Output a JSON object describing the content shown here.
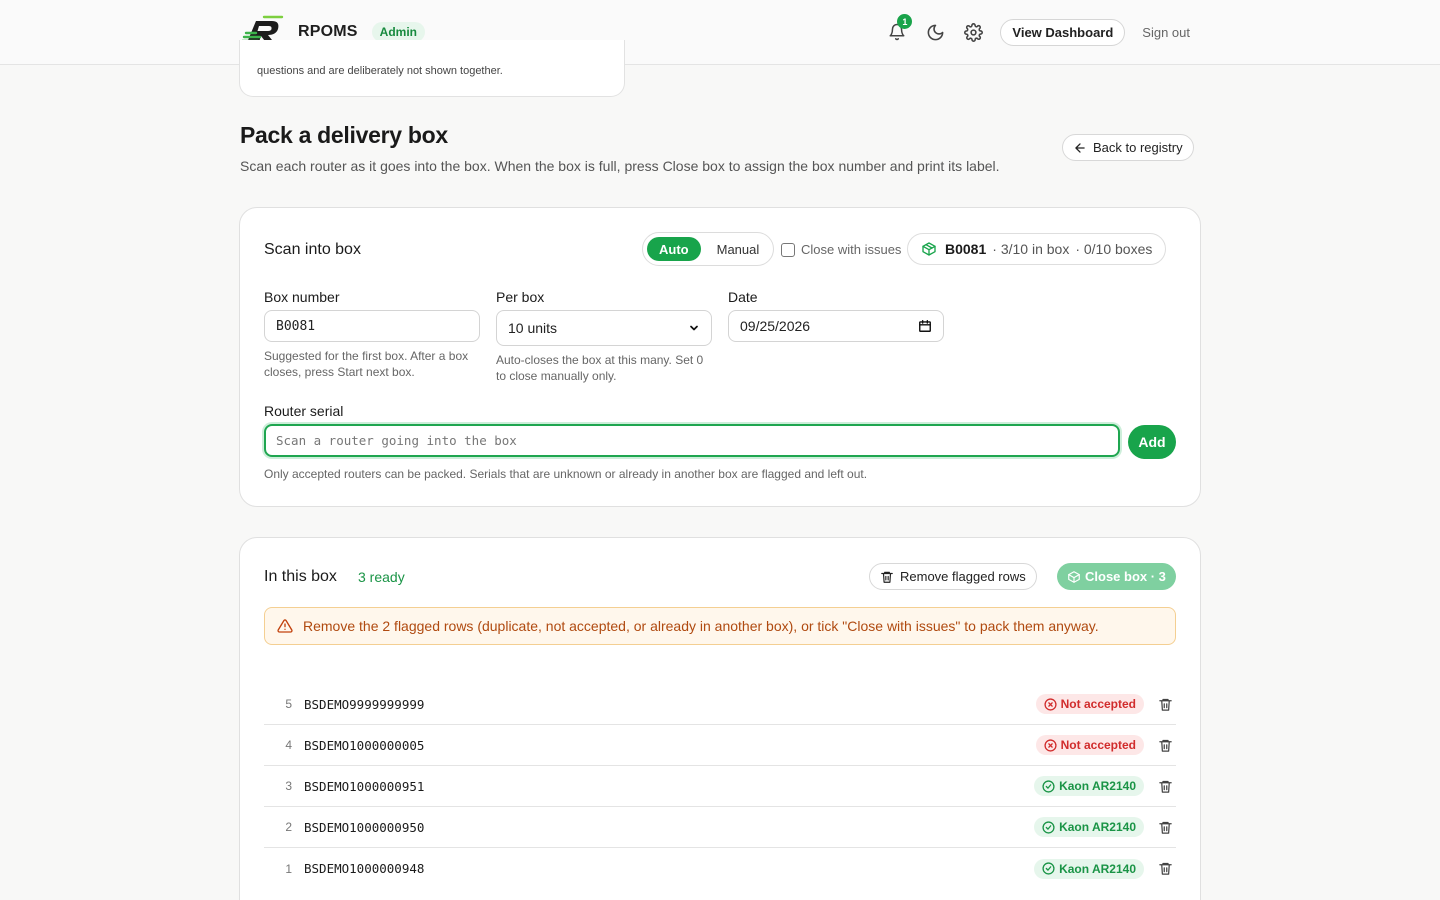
{
  "header": {
    "app_name": "RPOMS",
    "role": "Admin",
    "notification_count": "1",
    "view_dashboard": "View Dashboard",
    "sign_out": "Sign out"
  },
  "top_card": {
    "text": "questions and are deliberately not shown together."
  },
  "page": {
    "title": "Pack a delivery box",
    "subtitle": "Scan each router as it goes into the box. When the box is full, press Close box to assign the box number and print its label.",
    "back_label": "Back to registry"
  },
  "scan": {
    "title": "Scan into box",
    "mode_auto": "Auto",
    "mode_manual": "Manual",
    "close_with_issues": "Close with issues",
    "box_number_status": "B0081",
    "box_fill_status": "· 3/10 in box",
    "boxes_status": "· 0/10 boxes",
    "box_number_label": "Box number",
    "box_number_value": "B0081",
    "box_number_help": "Suggested for the first box. After a box closes, press Start next box.",
    "per_box_label": "Per box",
    "per_box_value": "10 units",
    "per_box_help": "Auto-closes the box at this many. Set 0 to close manually only.",
    "date_label": "Date",
    "date_value": "09/25/2026",
    "serial_label": "Router serial",
    "serial_placeholder": "Scan a router going into the box",
    "add_label": "Add",
    "serial_help": "Only accepted routers can be packed. Serials that are unknown or already in another box are flagged and left out."
  },
  "box": {
    "title": "In this box",
    "ready": "3 ready",
    "remove_flagged": "Remove flagged rows",
    "close_box": "Close box · 3",
    "alert": "Remove the 2 flagged rows (duplicate, not accepted, or already in another box), or tick \"Close with issues\" to pack them anyway.",
    "rows": [
      {
        "num": "5",
        "serial": "BSDEMO9999999999",
        "status": "Not accepted",
        "kind": "bad"
      },
      {
        "num": "4",
        "serial": "BSDEMO1000000005",
        "status": "Not accepted",
        "kind": "bad"
      },
      {
        "num": "3",
        "serial": "BSDEMO1000000951",
        "status": "Kaon AR2140",
        "kind": "good"
      },
      {
        "num": "2",
        "serial": "BSDEMO1000000950",
        "status": "Kaon AR2140",
        "kind": "good"
      },
      {
        "num": "1",
        "serial": "BSDEMO1000000948",
        "status": "Kaon AR2140",
        "kind": "good"
      }
    ]
  },
  "colors": {
    "accent": "#18a44b",
    "danger": "#d12c2c",
    "warning": "#b04a10"
  },
  "icons": [
    "logo-icon",
    "bell-icon",
    "moon-icon",
    "gear-icon",
    "arrow-left-icon",
    "box-icon",
    "calendar-icon",
    "chevron-down-icon",
    "warning-icon",
    "trash-icon",
    "x-circle-icon",
    "check-circle-icon"
  ]
}
